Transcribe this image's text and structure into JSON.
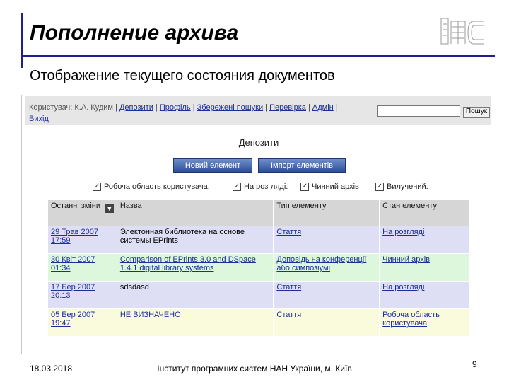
{
  "slide": {
    "title": "Пополнение архива",
    "subtitle": "Отображение текущего состояния документов",
    "footer_date": "18.03.2018",
    "footer_center": "Інститут програмних систем НАН України, м. Київ",
    "page_number": "9",
    "logo_text": "imc"
  },
  "topbar": {
    "user_prefix": "Користувач: К.А. Кудим",
    "links": [
      "Депозити",
      "Профіль",
      "Збережені пошуки",
      "Перевірка",
      "Адмін",
      "Вихід"
    ],
    "search_placeholder": "",
    "search_button": "Пошук"
  },
  "section_title": "Депозити",
  "buttons": {
    "new_item": "Новий елемент",
    "import_items": "Імпорт елементів"
  },
  "filters": [
    {
      "label": "Робоча область користувача.",
      "checked": true
    },
    {
      "label": "На розгляді.",
      "checked": true
    },
    {
      "label": "Чинний архів",
      "checked": true
    },
    {
      "label": "Вилучений.",
      "checked": true
    }
  ],
  "table": {
    "headers": [
      "Останні зміни",
      "Назва",
      "Тип елементу",
      "Стан елементу"
    ],
    "rows": [
      {
        "date1": "29 Трав 2007",
        "date2": "17:59",
        "title": "Электонная библиотека на основе системы EPrints",
        "type": "Стаття",
        "state": "На розгляді"
      },
      {
        "date1": "30 Квіт 2007",
        "date2": "01:34",
        "title": "Comparison of EPrints 3.0 and DSpace 1.4.1 digital library systems",
        "type": "Доповідь на конференції або симпозіумі",
        "state": "Чинний архів"
      },
      {
        "date1": "17 Бер 2007",
        "date2": "20:13",
        "title": "sdsdasd",
        "type": "Стаття",
        "state": "На розгляді"
      },
      {
        "date1": "05 Бер 2007",
        "date2": "19:47",
        "title": "НЕ ВИЗНАЧЕНО",
        "type": "Стаття",
        "state": "Робоча область користувача"
      }
    ]
  }
}
